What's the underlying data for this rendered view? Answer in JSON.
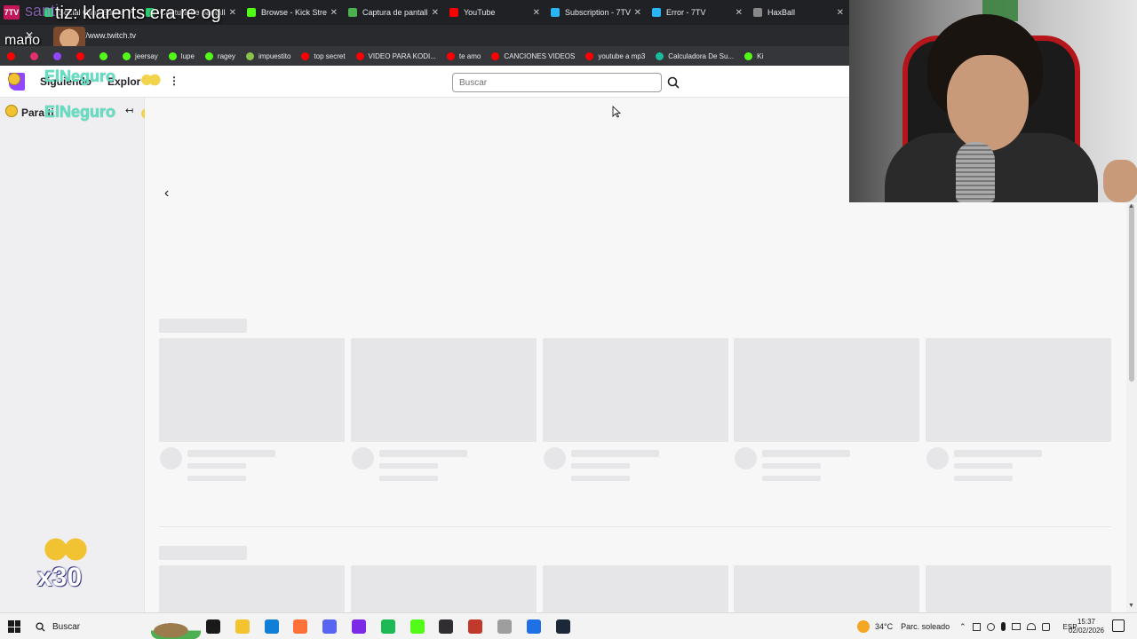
{
  "overlay": {
    "app_badge": "7TV",
    "title": "tiz: klarents era re og",
    "username": "santi",
    "mano_text": "mano",
    "emote_name": "ElNeguro",
    "badge_multiplier": "x30"
  },
  "browser": {
    "tabs": [
      {
        "label": "Social Clips Stream",
        "favicon_color": "#3ddc84"
      },
      {
        "label": "Captura de pantalla",
        "favicon_color": "#2ecc71"
      },
      {
        "label": "Browse - Kick Streaming",
        "favicon_color": "#53fc18"
      },
      {
        "label": "Captura de pantalla po",
        "favicon_color": "#4caf50"
      },
      {
        "label": "YouTube",
        "favicon_color": "#ff0000"
      },
      {
        "label": "Subscription - 7TV",
        "favicon_color": "#29b6f6"
      },
      {
        "label": "Error - 7TV",
        "favicon_color": "#29b6f6"
      },
      {
        "label": "HaxBall",
        "favicon_color": "#888888"
      }
    ],
    "url": "//www.twitch.tv",
    "bookmarks": [
      {
        "label": "",
        "color": "#ff0000"
      },
      {
        "label": "",
        "color": "#e1306c"
      },
      {
        "label": "",
        "color": "#9146ff"
      },
      {
        "label": "",
        "color": "#ff0000"
      },
      {
        "label": "",
        "color": "#53fc18"
      },
      {
        "label": "jeersay",
        "color": "#53fc18"
      },
      {
        "label": "lupe",
        "color": "#53fc18"
      },
      {
        "label": "ragey",
        "color": "#53fc18"
      },
      {
        "label": "impuestito",
        "color": "#8bc34a"
      },
      {
        "label": "top secret",
        "color": "#ff0000"
      },
      {
        "label": "VIDEO PARA KODI...",
        "color": "#ff0000"
      },
      {
        "label": "te amo",
        "color": "#ff0000"
      },
      {
        "label": "CANCIONES VIDEOS",
        "color": "#ff0000"
      },
      {
        "label": "youtube a mp3",
        "color": "#ff0000"
      },
      {
        "label": "Calculadora De Su...",
        "color": "#1abc9c"
      },
      {
        "label": "Ki",
        "color": "#53fc18"
      }
    ]
  },
  "twitch": {
    "nav": {
      "following": "Siguiendo",
      "browse": "Explor",
      "more_icon": "⋮"
    },
    "search": {
      "placeholder": "Buscar"
    },
    "sidebar": {
      "for_you": "Para ti",
      "collapse_icon": "↤"
    },
    "carousel_prev": "‹"
  },
  "taskbar": {
    "search_label": "Buscar",
    "weather": "34°C",
    "weather_desc": "Parc. soleado",
    "language": "ESP",
    "time": "15:37",
    "date": "02/02/2026",
    "apps": [
      {
        "name": "task-view-icon",
        "color": "#1a1a1a"
      },
      {
        "name": "file-explorer-icon",
        "color": "#f4c430"
      },
      {
        "name": "edge-icon",
        "color": "#0f7fd8"
      },
      {
        "name": "firefox-icon",
        "color": "#ff7139"
      },
      {
        "name": "discord-icon",
        "color": "#5865f2"
      },
      {
        "name": "canva-icon",
        "color": "#7d2ae8"
      },
      {
        "name": "spotify-icon",
        "color": "#1db954"
      },
      {
        "name": "kick-icon",
        "color": "#53fc18"
      },
      {
        "name": "obs-icon",
        "color": "#302e31"
      },
      {
        "name": "voicemeeter-icon",
        "color": "#c0392b"
      },
      {
        "name": "app-icon",
        "color": "#9e9e9e"
      },
      {
        "name": "roblox-icon",
        "color": "#1f6fe5"
      },
      {
        "name": "steam-icon",
        "color": "#1b2838"
      }
    ]
  }
}
